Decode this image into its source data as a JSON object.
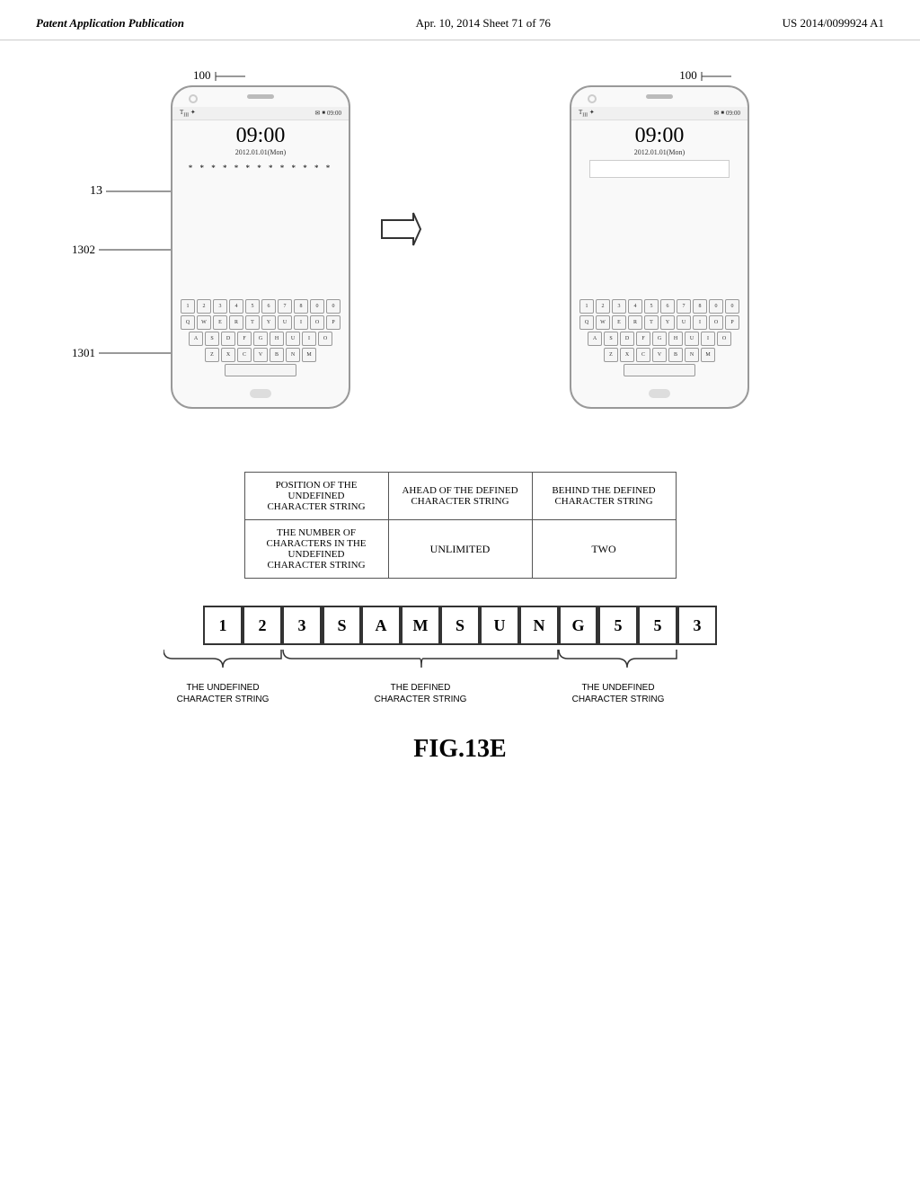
{
  "header": {
    "left": "Patent Application Publication",
    "center": "Apr. 10, 2014   Sheet 71 of 76",
    "right": "US 2014/0099924 A1"
  },
  "ref_labels": {
    "ref_100": "100",
    "ref_13": "13",
    "ref_1302": "1302",
    "ref_1301": "1301"
  },
  "phone": {
    "time": "09:00",
    "date": "2012.01.01(Mon)",
    "status_bar_left": "Tᴵᴵᴵ  ☖",
    "status_bar_right": "09:00",
    "password_dots": "* * * * * * * * * * * * *",
    "keyboard_rows": [
      [
        "1",
        "2",
        "3",
        "4",
        "5",
        "6",
        "7",
        "8",
        "0",
        "0"
      ],
      [
        "Q",
        "W",
        "E",
        "R",
        "T",
        "Y",
        "U",
        "I",
        "O",
        "P"
      ],
      [
        "A",
        "S",
        "D",
        "F",
        "G",
        "H",
        "U",
        "I",
        "O"
      ],
      [
        "Z",
        "X",
        "C",
        "V",
        "B",
        "N",
        "M"
      ]
    ]
  },
  "table": {
    "col1_row1": "POSITION OF THE UNDEFINED CHARACTER STRING",
    "col2_row1": "AHEAD OF THE DEFINED CHARACTER STRING",
    "col3_row1": "BEHIND THE DEFINED CHARACTER STRING",
    "col1_row2": "THE NUMBER OF CHARACTERS IN THE UNDEFINED CHARACTER STRING",
    "col2_row2": "UNLIMITED",
    "col3_row2": "TWO"
  },
  "char_string": {
    "chars": [
      "1",
      "2",
      "3",
      "S",
      "A",
      "M",
      "S",
      "U",
      "N",
      "G",
      "5",
      "5",
      "3"
    ],
    "brace_labels": {
      "left": "THE UNDEFINED\nCHARACTER STRING",
      "center": "THE DEFINED\nCHARACTER STRING",
      "right": "THE UNDEFINED\nCHARACTER STRING"
    }
  },
  "figure_label": "FIG.13E"
}
